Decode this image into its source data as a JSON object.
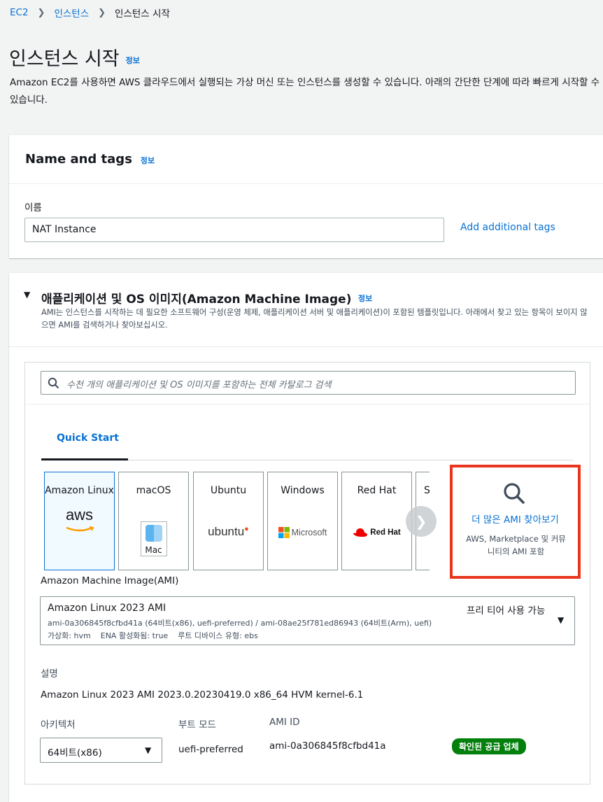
{
  "breadcrumb": {
    "items": [
      "EC2",
      "인스턴스",
      "인스턴스 시작"
    ]
  },
  "page": {
    "title": "인스턴스 시작",
    "info": "정보",
    "description": "Amazon EC2를 사용하면 AWS 클라우드에서 실행되는 가상 머신 또는 인스턴스를 생성할 수 있습니다. 아래의 간단한 단계에 따라 빠르게 시작할 수 있습니다."
  },
  "name_tags": {
    "title": "Name and tags",
    "info": "정보",
    "name_label": "이름",
    "name_value": "NAT Instance",
    "add_tags": "Add additional tags"
  },
  "ami_section": {
    "title": "애플리케이션 및 OS 이미지(Amazon Machine Image)",
    "info": "정보",
    "description": "AMI는 인스턴스를 시작하는 데 필요한 소프트웨어 구성(운영 체제, 애플리케이션 서버 및 애플리케이션)이 포함된 템플릿입니다. 아래에서 찾고 있는 항목이 보이지 않으면 AMI를 검색하거나 찾아보십시오.",
    "search_placeholder": "수천 개의 애플리케이션 및 OS 이미지를 포함하는 전체 카탈로그 검색",
    "tab": "Quick Start",
    "tiles": [
      {
        "name": "Amazon Linux",
        "logo": "aws"
      },
      {
        "name": "macOS",
        "logo": "Mac"
      },
      {
        "name": "Ubuntu",
        "logo": "ubuntu"
      },
      {
        "name": "Windows",
        "logo": "Microsoft"
      },
      {
        "name": "Red Hat",
        "logo": "Red Hat"
      },
      {
        "name": "S",
        "logo": ""
      }
    ],
    "browse_more": {
      "title": "더 많은 AMI 찾아보기",
      "subtitle": "AWS, Marketplace 및 커뮤니티의 AMI 포함"
    },
    "ami_label": "Amazon Machine Image(AMI)",
    "ami_select": {
      "name": "Amazon Linux 2023 AMI",
      "free_tier": "프리 티어 사용 가능",
      "ids": "ami-0a306845f8cfbd41a (64비트(x86), uefi-preferred) / ami-08ae25f781ed86943 (64비트(Arm), uefi)",
      "meta": "가상화: hvm    ENA 활성화됨: true    루트 디바이스 유형: ebs"
    },
    "desc_label": "설명",
    "desc_value": "Amazon Linux 2023 AMI 2023.0.20230419.0 x86_64 HVM kernel-6.1",
    "arch_label": "아키텍처",
    "arch_value": "64비트(x86)",
    "boot_label": "부트 모드",
    "boot_value": "uefi-preferred",
    "amiid_label": "AMI ID",
    "amiid_value": "ami-0a306845f8cfbd41a",
    "verified": "확인된 공급 업체"
  },
  "colors": {
    "link": "#0972d3",
    "highlight": "#e8361e",
    "verified": "#037f0c"
  }
}
